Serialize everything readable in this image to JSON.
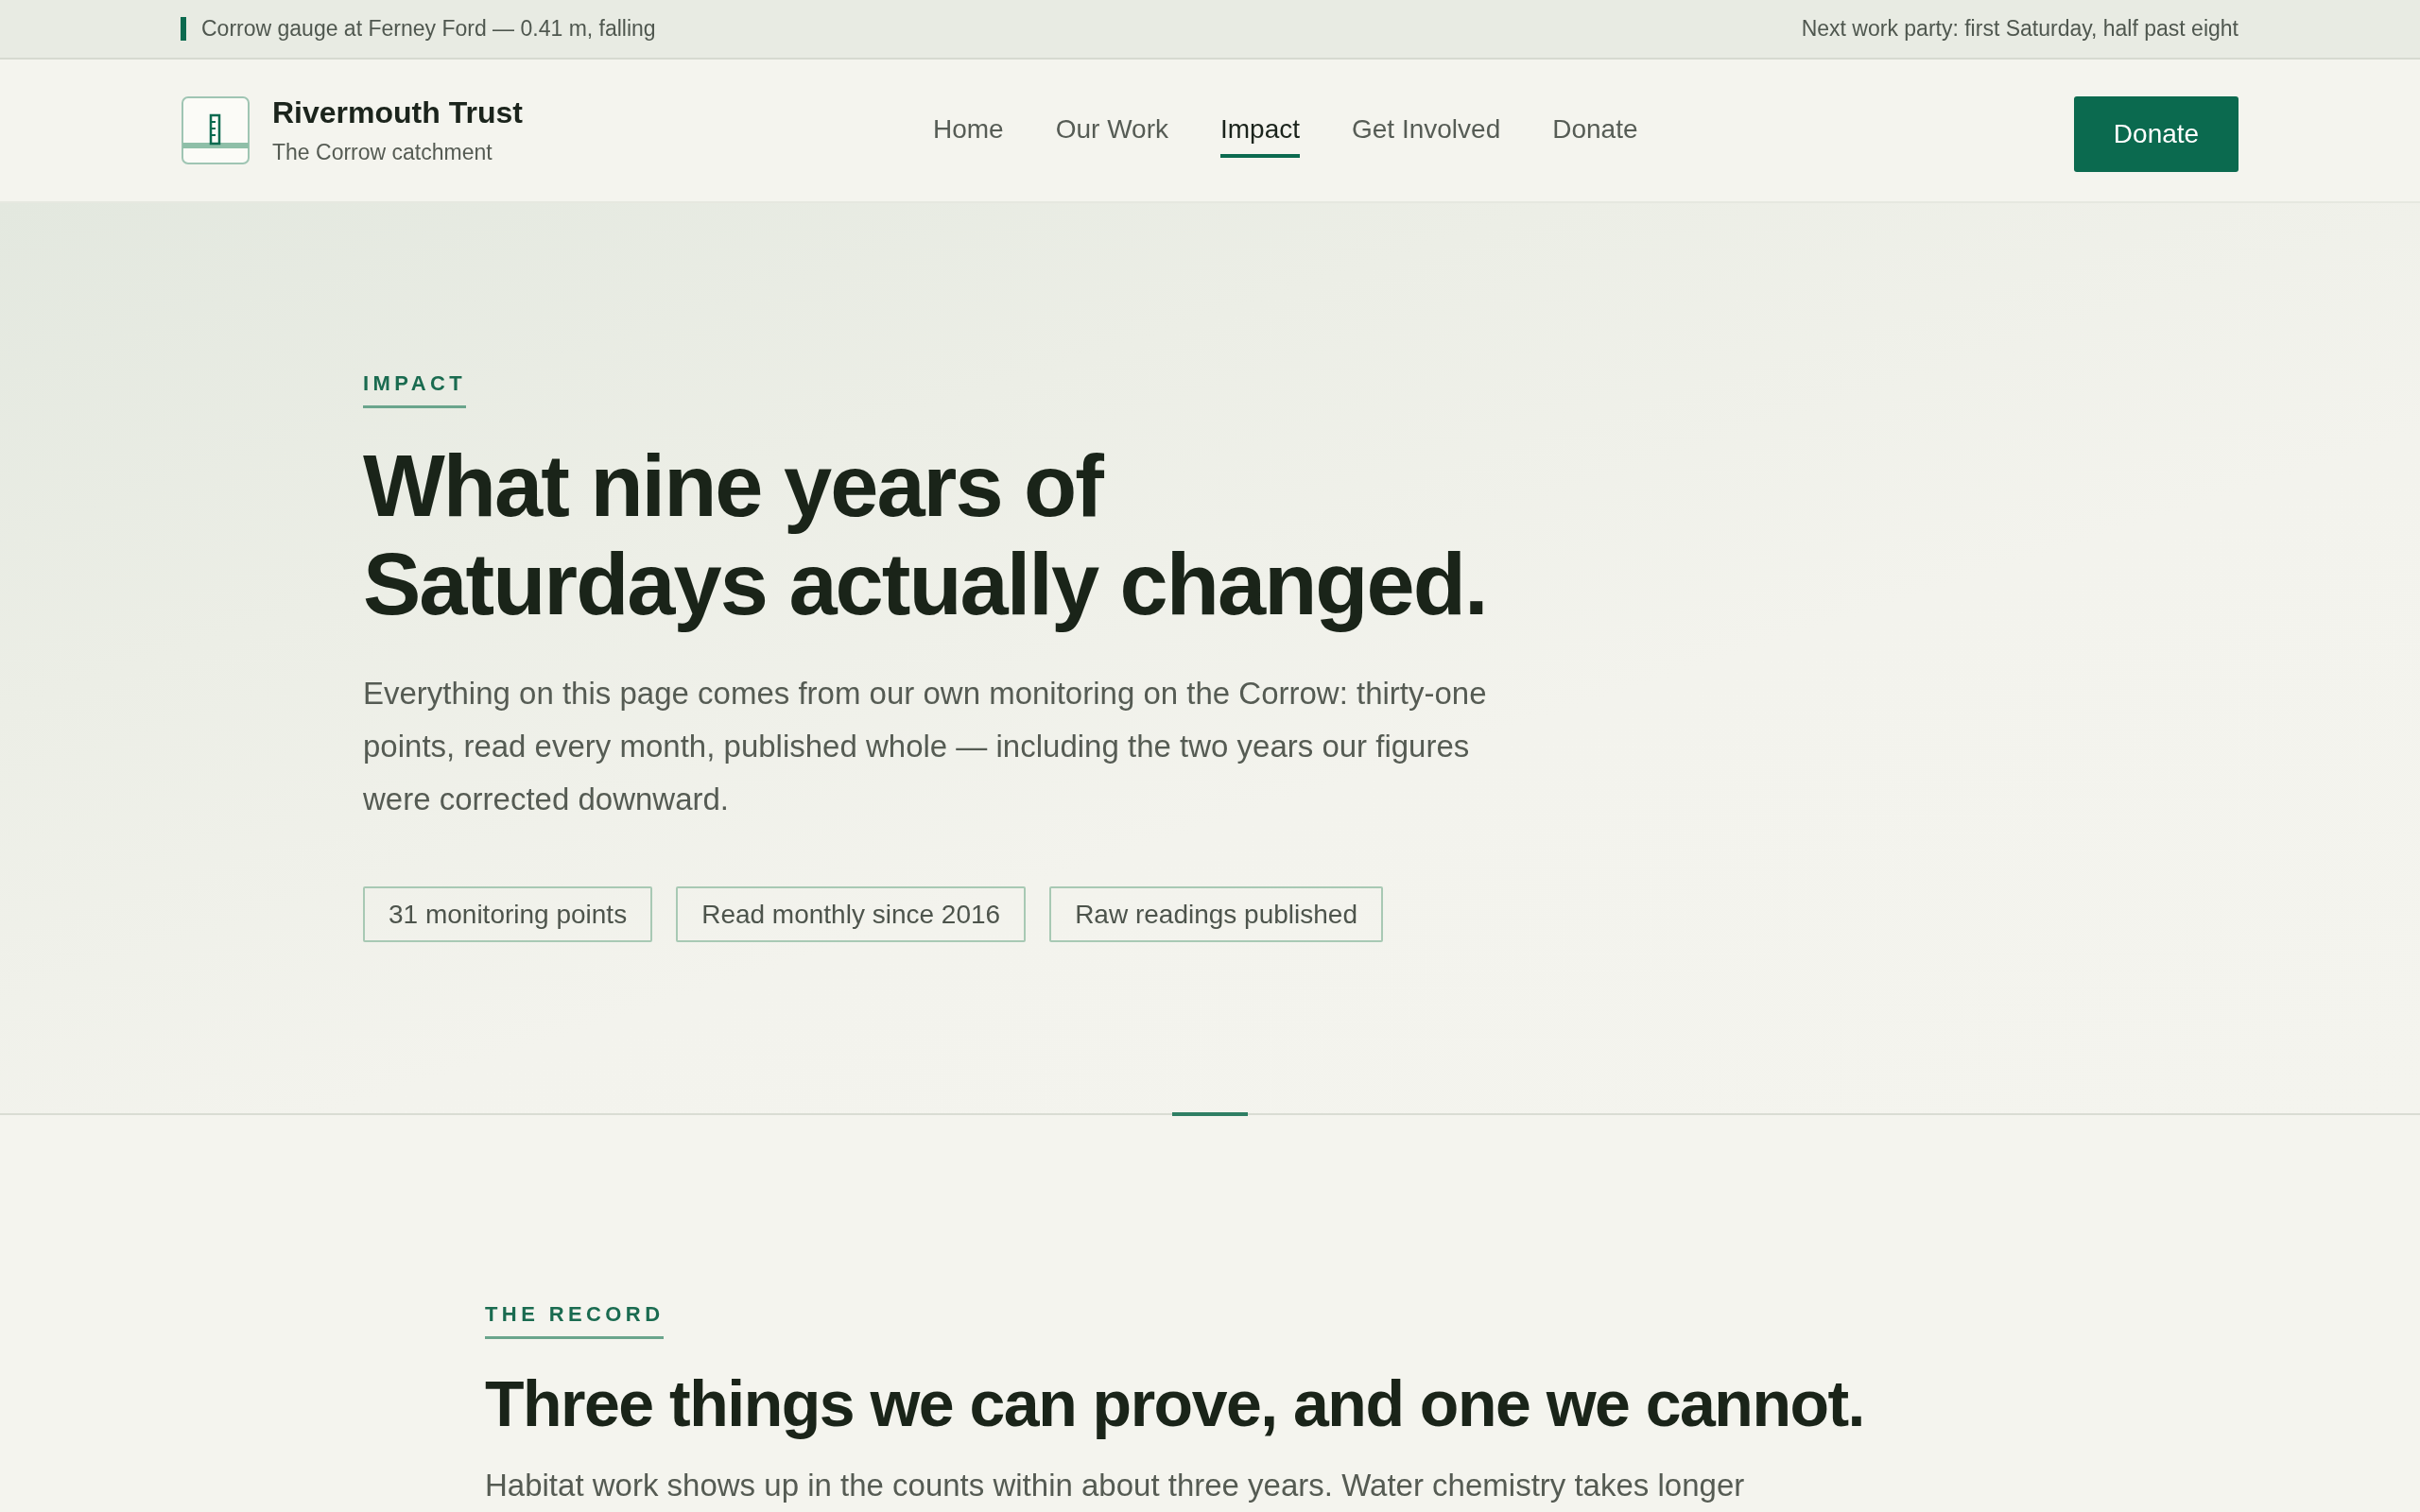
{
  "top_bar": {
    "gauge_reading": "Corrow gauge at Ferney Ford — 0.41 m, falling",
    "notice": "Next work party: first Saturday, half past eight"
  },
  "header": {
    "brand": {
      "name": "Rivermouth Trust",
      "tagline": "The Corrow catchment"
    },
    "nav": [
      {
        "label": "Home",
        "selected": false
      },
      {
        "label": "Our Work",
        "selected": false
      },
      {
        "label": "Impact",
        "selected": true
      },
      {
        "label": "Get Involved",
        "selected": false
      },
      {
        "label": "Donate",
        "selected": false
      }
    ],
    "cta": "Donate"
  },
  "hero": {
    "eyebrow": "IMPACT",
    "title_lines": [
      "What nine years of",
      "Saturdays actually changed."
    ],
    "lead": "Everything on this page comes from our own monitoring on the Corrow: thirty-one points, read every month, published whole — including the two years our figures were corrected downward.",
    "tags": [
      "31 monitoring points",
      "Read monthly since 2016",
      "Raw readings published"
    ]
  },
  "record": {
    "eyebrow": "THE RECORD",
    "title": "Three things we can prove, and one we cannot.",
    "intro": "Habitat work shows up in the counts within about three years. Water chemistry takes longer"
  }
}
